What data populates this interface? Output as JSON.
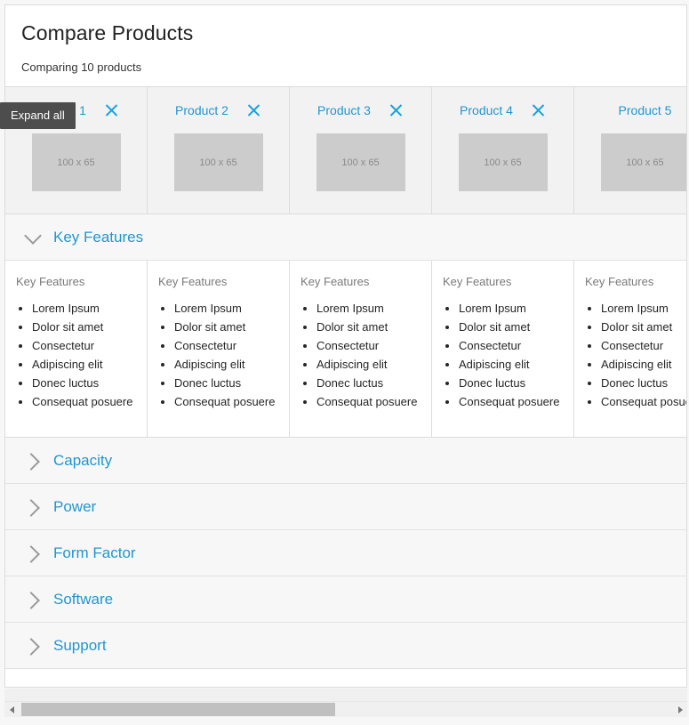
{
  "header": {
    "title": "Compare Products",
    "subtitle": "Comparing 10 products"
  },
  "tooltip": {
    "label": "Expand all"
  },
  "colors": {
    "accent": "#2196cf",
    "close_icon": "#19a3dd",
    "tooltip_bg": "#4d4d4d",
    "section_bg": "#f7f7f7",
    "strip_bg": "#f2f2f2",
    "thumb_bg": "#cccccc",
    "border": "#dcdcdc"
  },
  "products": [
    {
      "name": "Product 1",
      "thumb_label": "100 x 65",
      "close_icon": "close-icon",
      "has_close": true
    },
    {
      "name": "Product 2",
      "thumb_label": "100 x 65",
      "close_icon": "close-icon",
      "has_close": true
    },
    {
      "name": "Product 3",
      "thumb_label": "100 x 65",
      "close_icon": "close-icon",
      "has_close": true
    },
    {
      "name": "Product 4",
      "thumb_label": "100 x 65",
      "close_icon": "close-icon",
      "has_close": true
    },
    {
      "name": "Product 5",
      "thumb_label": "100 x 65",
      "close_icon": "close-icon",
      "has_close": false
    }
  ],
  "sections": [
    {
      "label": "Key Features",
      "expanded": true,
      "icon": "chevron-down-icon"
    },
    {
      "label": "Capacity",
      "expanded": false,
      "icon": "chevron-right-icon"
    },
    {
      "label": "Power",
      "expanded": false,
      "icon": "chevron-right-icon"
    },
    {
      "label": "Form Factor",
      "expanded": false,
      "icon": "chevron-right-icon"
    },
    {
      "label": "Software",
      "expanded": false,
      "icon": "chevron-right-icon"
    },
    {
      "label": "Support",
      "expanded": false,
      "icon": "chevron-right-icon"
    }
  ],
  "key_features_body": {
    "cells": [
      {
        "heading": "Key Features",
        "items": [
          "Lorem Ipsum",
          "Dolor sit amet",
          "Consectetur",
          "Adipiscing elit",
          "Donec luctus",
          "Consequat posuere"
        ]
      },
      {
        "heading": "Key Features",
        "items": [
          "Lorem Ipsum",
          "Dolor sit amet",
          "Consectetur",
          "Adipiscing elit",
          "Donec luctus",
          "Consequat posuere"
        ]
      },
      {
        "heading": "Key Features",
        "items": [
          "Lorem Ipsum",
          "Dolor sit amet",
          "Consectetur",
          "Adipiscing elit",
          "Donec luctus",
          "Consequat posuere"
        ]
      },
      {
        "heading": "Key Features",
        "items": [
          "Lorem Ipsum",
          "Dolor sit amet",
          "Consectetur",
          "Adipiscing elit",
          "Donec luctus",
          "Consequat posuere"
        ]
      },
      {
        "heading": "Key Features",
        "items": [
          "Lorem Ipsum",
          "Dolor sit amet",
          "Consectetur",
          "Adipiscing elit",
          "Donec luctus",
          "Consequat posuere"
        ]
      }
    ]
  },
  "scrollbar": {
    "left_arrow_icon": "triangle-left-icon",
    "right_arrow_icon": "triangle-right-icon",
    "thumb_position_pct": 0,
    "thumb_width_pct": 47
  }
}
